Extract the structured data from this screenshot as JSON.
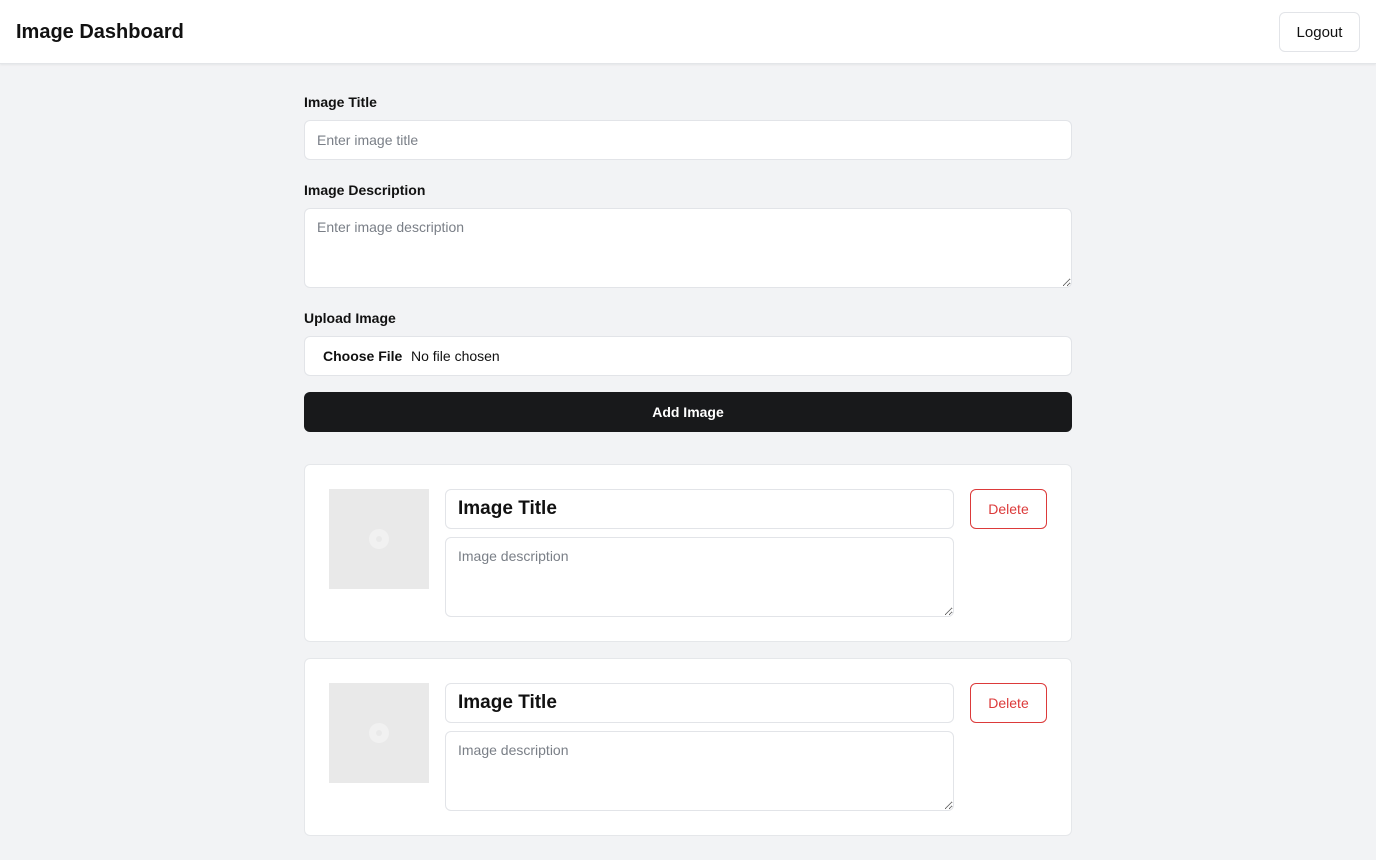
{
  "header": {
    "title": "Image Dashboard",
    "logout_label": "Logout"
  },
  "form": {
    "title_label": "Image Title",
    "title_placeholder": "Enter image title",
    "description_label": "Image Description",
    "description_placeholder": "Enter image description",
    "upload_label": "Upload Image",
    "choose_file_label": "Choose File",
    "file_status": "No file chosen",
    "add_button_label": "Add Image"
  },
  "cards": [
    {
      "title_value": "Image Title",
      "description_placeholder": "Image description",
      "delete_label": "Delete",
      "thumbnail_icon": "image-placeholder-icon"
    },
    {
      "title_value": "Image Title",
      "description_placeholder": "Image description",
      "delete_label": "Delete",
      "thumbnail_icon": "image-placeholder-icon"
    }
  ],
  "colors": {
    "background": "#f2f3f5",
    "primary_button": "#18191b",
    "danger": "#dc3a3a"
  }
}
